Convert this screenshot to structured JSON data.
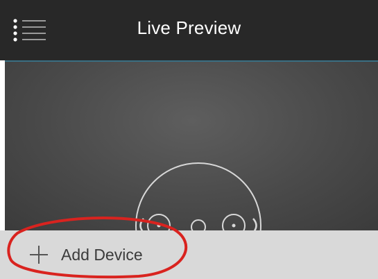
{
  "header": {
    "menu_icon": "hamburger-list-icon",
    "title": "Live Preview",
    "background": "#282828",
    "title_color": "#ffffff"
  },
  "preview": {
    "placeholder_icon": "camera-face-icon",
    "background": "#4a4a4a"
  },
  "bottom_bar": {
    "add_icon": "plus-icon",
    "add_label": "Add Device",
    "background": "#d9d9d9"
  },
  "annotation": {
    "type": "red-ellipse-highlight",
    "color": "#d9231f"
  }
}
